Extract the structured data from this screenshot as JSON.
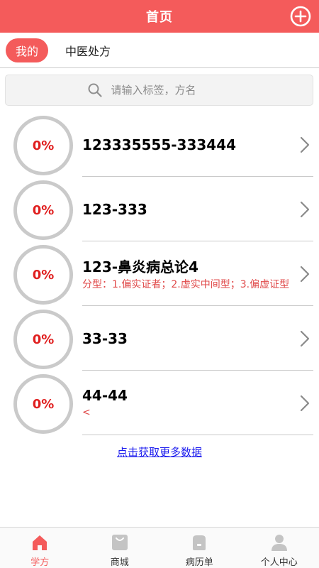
{
  "header": {
    "title": "首页"
  },
  "tabs": [
    {
      "label": "我的",
      "active": true
    },
    {
      "label": "中医处方",
      "active": false
    }
  ],
  "search": {
    "placeholder": "请输入标签，方名"
  },
  "items": [
    {
      "percent": "0%",
      "title": "123335555-333444",
      "subtitle": ""
    },
    {
      "percent": "0%",
      "title": "123-333",
      "subtitle": ""
    },
    {
      "percent": "0%",
      "title": "123-鼻炎病总论4",
      "subtitle": "分型：1.偏实证者；2.虚实中间型；3.偏虚证型"
    },
    {
      "percent": "0%",
      "title": "33-33",
      "subtitle": ""
    },
    {
      "percent": "0%",
      "title": "44-44",
      "subtitle": "<"
    }
  ],
  "load_more": "点击获取更多数据",
  "bottom_nav": [
    {
      "label": "学方",
      "icon": "home-icon",
      "active": true
    },
    {
      "label": "商城",
      "icon": "shopping-bag-icon",
      "active": false
    },
    {
      "label": "病历单",
      "icon": "medical-record-icon",
      "active": false
    },
    {
      "label": "个人中心",
      "icon": "user-icon",
      "active": false
    }
  ],
  "colors": {
    "accent": "#f45b5b",
    "percent": "#e02020",
    "link": "#1a1aee",
    "nav_inactive": "#c4c4c4"
  }
}
